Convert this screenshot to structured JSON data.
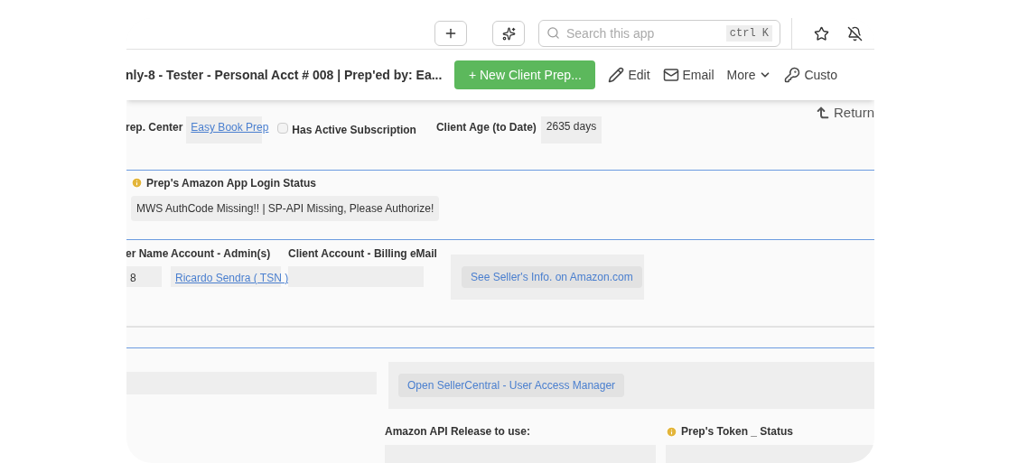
{
  "toolbar": {
    "search": {
      "placeholder": "Search this app",
      "shortcut": "ctrl K"
    }
  },
  "header": {
    "title": "nly-8 - Tester - Personal Acct # 008 | Prep'ed by: Ea...",
    "primary_button": "+ New Client Prep...",
    "actions": [
      {
        "kind": "edit",
        "label": "Edit"
      },
      {
        "kind": "email",
        "label": "Email"
      },
      {
        "kind": "more",
        "label": "More"
      },
      {
        "kind": "customize",
        "label": "Custo"
      }
    ]
  },
  "return_link": "Return",
  "summary": {
    "prep_center": {
      "label": "rep. Center",
      "value": "Easy Book Prep"
    },
    "subscription": {
      "label": "Has Active Subscription",
      "checked": false
    },
    "client_age": {
      "label": "Client Age (to Date)",
      "value": "2635 days"
    }
  },
  "login_status": {
    "label": "Prep's Amazon App Login Status",
    "value": "MWS AuthCode Missing!! | SP-API Missing, Please Authorize!"
  },
  "account": {
    "columns": [
      {
        "label": "er Name",
        "value": "8",
        "link": false
      },
      {
        "label": "Account - Admin(s)",
        "value": "Ricardo Sendra ( TSN )",
        "link": true
      },
      {
        "label": "Client  Account - Billing eMail",
        "link": false
      }
    ],
    "button": "See Seller's Info. on Amazon.com"
  },
  "seller_central": {
    "button": "Open SellerCentral - User Access Manager"
  },
  "bottom": {
    "api_release_label": "Amazon API Release to use:",
    "token_status_label": "Prep's Token _ Status"
  }
}
